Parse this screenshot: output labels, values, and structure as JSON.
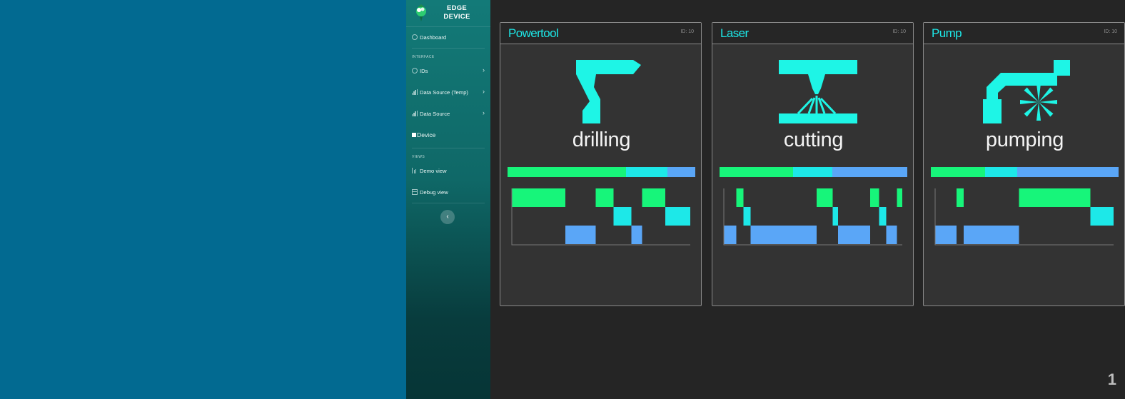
{
  "sidebar": {
    "brand_line1": "EDGE",
    "brand_line2": "DEVICE",
    "dashboard": "Dashboard",
    "heading_interface": "INTERFACE",
    "ids": "IDs",
    "data_source_temp": "Data Source (Temp)",
    "data_source": "Data Source",
    "device": "Device",
    "heading_views": "VIEWS",
    "demo_view": "Demo view",
    "debug_view": "Debug view",
    "collapse_glyph": "‹",
    "chevron_glyph": "›"
  },
  "colors": {
    "green": "#17f57a",
    "cyan": "#1de8e8",
    "blue": "#5aa6f7",
    "icon": "#1ef5e6"
  },
  "cards": [
    {
      "title": "Powertool",
      "id_label": "ID: 10",
      "state": "drilling",
      "icon": "drill-icon",
      "ratio": [
        0.63,
        0.22,
        0.15
      ],
      "timeline": [
        {
          "lane": 0,
          "start": 0,
          "end": 0.3
        },
        {
          "lane": 2,
          "start": 0.3,
          "end": 0.47
        },
        {
          "lane": 0,
          "start": 0.47,
          "end": 0.57
        },
        {
          "lane": 1,
          "start": 0.57,
          "end": 0.67
        },
        {
          "lane": 2,
          "start": 0.67,
          "end": 0.73
        },
        {
          "lane": 0,
          "start": 0.73,
          "end": 0.86
        },
        {
          "lane": 1,
          "start": 0.86,
          "end": 1.0
        }
      ]
    },
    {
      "title": "Laser",
      "id_label": "ID: 10",
      "state": "cutting",
      "icon": "laser-cutter-icon",
      "ratio": [
        0.39,
        0.21,
        0.4
      ],
      "timeline": [
        {
          "lane": 2,
          "start": 0,
          "end": 0.07
        },
        {
          "lane": 0,
          "start": 0.07,
          "end": 0.11
        },
        {
          "lane": 1,
          "start": 0.11,
          "end": 0.15
        },
        {
          "lane": 2,
          "start": 0.15,
          "end": 0.52
        },
        {
          "lane": 0,
          "start": 0.52,
          "end": 0.61
        },
        {
          "lane": 1,
          "start": 0.61,
          "end": 0.64
        },
        {
          "lane": 2,
          "start": 0.64,
          "end": 0.82
        },
        {
          "lane": 0,
          "start": 0.82,
          "end": 0.87
        },
        {
          "lane": 1,
          "start": 0.87,
          "end": 0.91
        },
        {
          "lane": 2,
          "start": 0.91,
          "end": 0.97
        },
        {
          "lane": 0,
          "start": 0.97,
          "end": 1.0
        }
      ]
    },
    {
      "title": "Pump",
      "id_label": "ID: 10",
      "state": "pumping",
      "icon": "pump-icon",
      "ratio": [
        0.29,
        0.17,
        0.54
      ],
      "timeline": [
        {
          "lane": 2,
          "start": 0,
          "end": 0.12
        },
        {
          "lane": 0,
          "start": 0.12,
          "end": 0.16
        },
        {
          "lane": 2,
          "start": 0.16,
          "end": 0.47
        },
        {
          "lane": 0,
          "start": 0.47,
          "end": 0.87
        },
        {
          "lane": 1,
          "start": 0.87,
          "end": 1.0
        }
      ]
    }
  ],
  "page_number": "1"
}
